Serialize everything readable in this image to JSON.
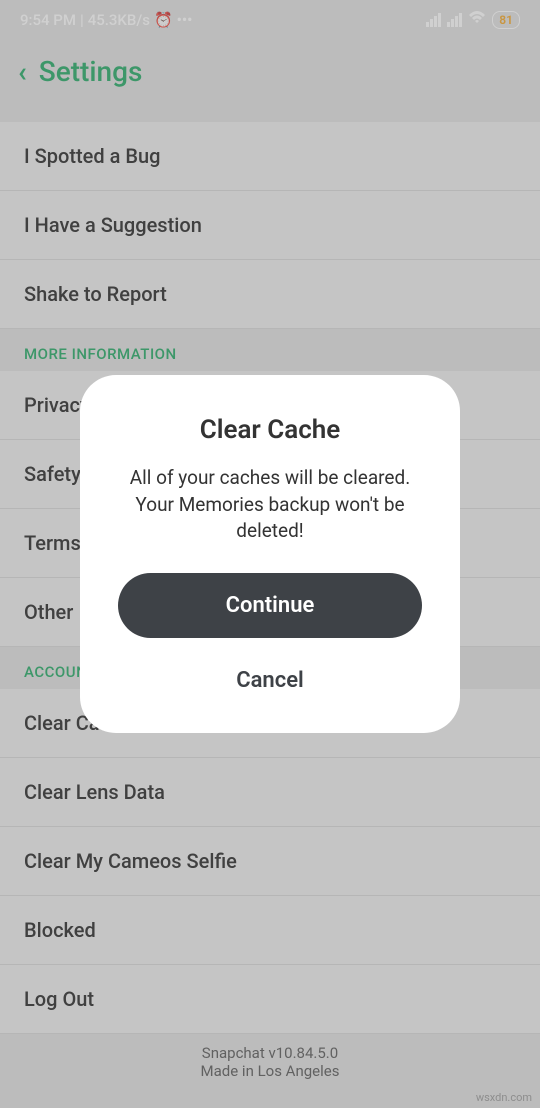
{
  "statusbar": {
    "time": "9:54 PM",
    "speed": "45.3KB/s",
    "battery": "81"
  },
  "header": {
    "title": "Settings"
  },
  "sections": {
    "feedback": {
      "items": [
        "I Spotted a Bug",
        "I Have a Suggestion",
        "Shake to Report"
      ]
    },
    "more_info": {
      "title": "MORE INFORMATION",
      "items": [
        "Privacy",
        "Safety",
        "Terms",
        "Other"
      ]
    },
    "account": {
      "title": "ACCOUNT ACTIONS",
      "items": [
        "Clear Cache",
        "Clear Lens Data",
        "Clear My Cameos Selfie",
        "Blocked",
        "Log Out"
      ]
    }
  },
  "footer": {
    "version": "Snapchat v10.84.5.0",
    "location": "Made in Los Angeles"
  },
  "dialog": {
    "title": "Clear Cache",
    "message": "All of your caches will be cleared. Your Memories backup won't be deleted!",
    "continue": "Continue",
    "cancel": "Cancel"
  },
  "watermark": "wsxdn.com"
}
